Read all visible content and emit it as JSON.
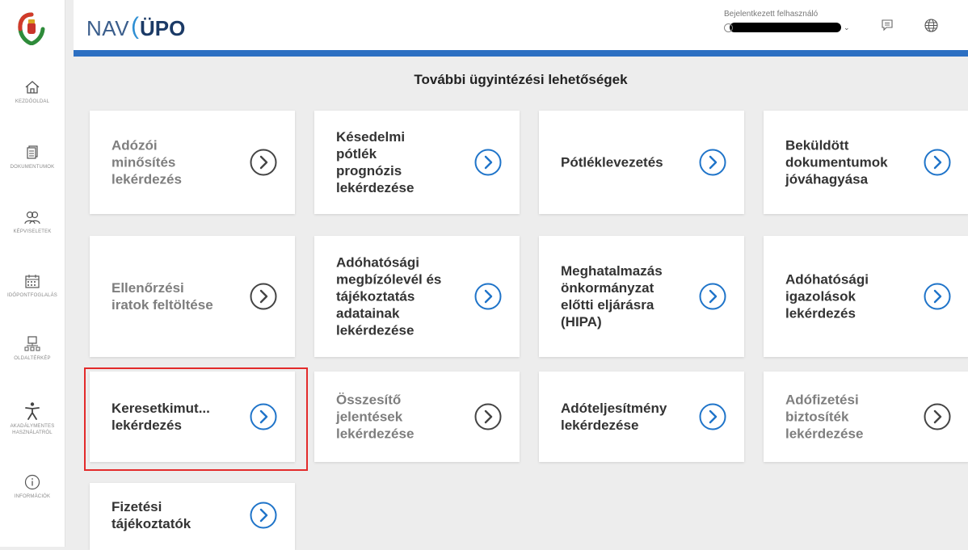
{
  "header": {
    "brand_nav": "NAV",
    "brand_paren": "(",
    "brand_upo": "ÜPO",
    "user_caption": "Bejelentkezett felhasználó",
    "user_chevron": "⌄"
  },
  "sidebar": {
    "items": [
      {
        "label": "Kezdőoldal",
        "icon": "home-icon"
      },
      {
        "label": "Dokumentumok",
        "icon": "documents-icon"
      },
      {
        "label": "Képviseletek",
        "icon": "users-icon"
      },
      {
        "label": "Időpontfoglalás",
        "icon": "calendar-icon"
      },
      {
        "label": "Oldaltérkép",
        "icon": "sitemap-icon"
      },
      {
        "label": "Akadálymentes használatról",
        "icon": "accessibility-icon"
      },
      {
        "label": "Információk",
        "icon": "info-icon"
      }
    ]
  },
  "main": {
    "title": "További ügyintézési lehetőségek",
    "cards": [
      {
        "label": "Adózói\nminősítés\nlekérdezés",
        "enabled": false
      },
      {
        "label": "Késedelmi\npótlék\nprognózis\nlekérdezése",
        "enabled": true
      },
      {
        "label": "Pótléklevezetés",
        "enabled": true
      },
      {
        "label": "Beküldött\ndokumentumok\njóváhagyása",
        "enabled": true
      },
      {
        "label": "Ellenőrzési\niratok feltöltése",
        "enabled": false
      },
      {
        "label": "Adóhatósági\nmegbízólevél és\ntájékoztatás\nadatainak\nlekérdezése",
        "enabled": true
      },
      {
        "label": "Meghatalmazás\nönkormányzat\nelőtti eljárásra\n(HIPA)",
        "enabled": true
      },
      {
        "label": "Adóhatósági\nigazolások\nlekérdezés",
        "enabled": true
      },
      {
        "label": "Keresetkimut...\nlekérdezés",
        "enabled": true
      },
      {
        "label": "Összesítő\njelentések\nlekérdezése",
        "enabled": false
      },
      {
        "label": "Adóteljesítmény\nlekérdezése",
        "enabled": true
      },
      {
        "label": "Adófizetési\nbiztosíték\nlekérdezése",
        "enabled": false
      },
      {
        "label": "Fizetési\ntájékoztatók",
        "enabled": true
      }
    ]
  },
  "colors": {
    "accent_blue": "#2c6fc2",
    "arrow_blue": "#1f74c9",
    "arrow_gray": "#444444",
    "highlight_red": "#e32b2b"
  }
}
